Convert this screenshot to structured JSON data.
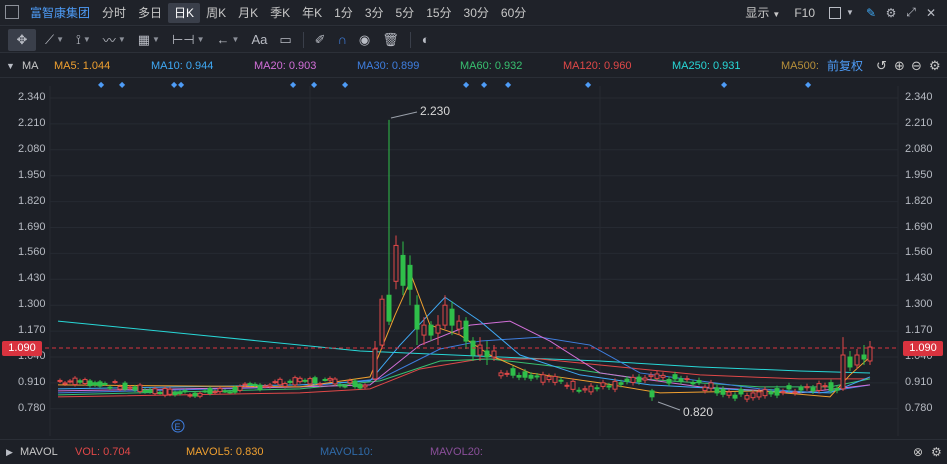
{
  "top": {
    "stock_name": "富智康集团",
    "timeframes": [
      "分时",
      "多日",
      "日K",
      "周K",
      "月K",
      "季K",
      "年K",
      "1分",
      "3分",
      "5分",
      "15分",
      "30分",
      "60分"
    ],
    "active_timeframe": "日K",
    "display_label": "显示",
    "f10_label": "F10"
  },
  "toolbar": {
    "text_tool": "Aa"
  },
  "ma_bar": {
    "indicator": "MA",
    "ma5": "MA5: 1.044",
    "ma10": "MA10: 0.944",
    "ma20": "MA20: 0.903",
    "ma30": "MA30: 0.899",
    "ma60": "MA60: 0.932",
    "ma120": "MA120: 0.960",
    "ma250": "MA250: 0.931",
    "ma500": "MA500:",
    "adjust": "前复权",
    "colors": {
      "ma5": "#f0a030",
      "ma10": "#3fa9f5",
      "ma20": "#d26fd8",
      "ma30": "#3f7fe0",
      "ma60": "#38c070",
      "ma120": "#e04848",
      "ma250": "#28d7d7",
      "ma500": "#b8903a"
    }
  },
  "axis": {
    "ticks": [
      "2.340",
      "2.210",
      "2.080",
      "1.950",
      "1.820",
      "1.690",
      "1.560",
      "1.430",
      "1.300",
      "1.170",
      "1.040",
      "0.910",
      "0.780"
    ],
    "current_price": "1.090",
    "high_label": "2.230",
    "low_label": "0.820",
    "event_marker": "E"
  },
  "vol_bar": {
    "indicator": "MAVOL",
    "vol": "VOL: 0.704",
    "mavol5": "MAVOL5: 0.830",
    "mavol10": "MAVOL10:",
    "mavol20": "MAVOL20:"
  }
}
